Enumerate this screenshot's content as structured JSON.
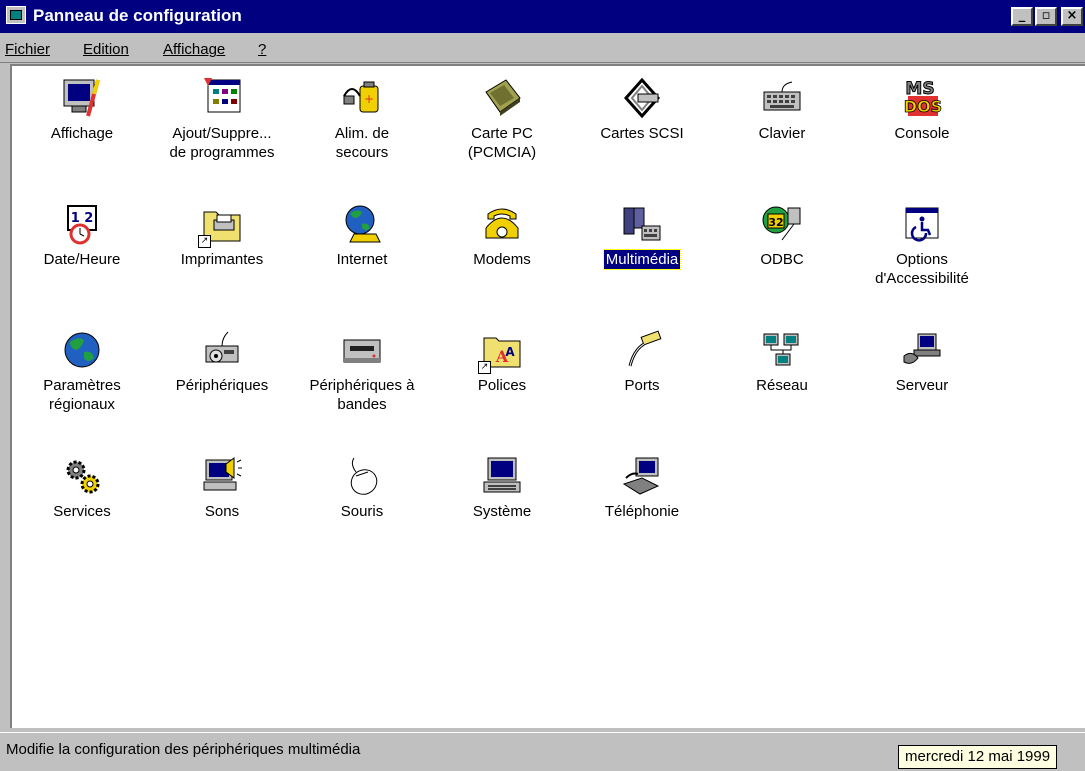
{
  "window": {
    "title": "Panneau de configuration",
    "minimize_symbol": "_",
    "maximize_symbol": "▫",
    "close_symbol": "×"
  },
  "menu": [
    "Fichier",
    "Edition",
    "Affichage",
    "?"
  ],
  "items": [
    {
      "label": "Affichage",
      "icon": "display-icon"
    },
    {
      "label": "Ajout/Suppre...\nde programmes",
      "icon": "add-remove-programs-icon"
    },
    {
      "label": "Alim. de\nsecours",
      "icon": "ups-icon"
    },
    {
      "label": "Carte PC\n(PCMCIA)",
      "icon": "pc-card-icon"
    },
    {
      "label": "Cartes SCSI",
      "icon": "scsi-icon"
    },
    {
      "label": "Clavier",
      "icon": "keyboard-icon"
    },
    {
      "label": "Console",
      "icon": "console-icon"
    },
    {
      "label": "Date/Heure",
      "icon": "calendar-clock-icon"
    },
    {
      "label": "Imprimantes",
      "icon": "printers-folder-icon"
    },
    {
      "label": "Internet",
      "icon": "internet-globe-phone-icon"
    },
    {
      "label": "Modems",
      "icon": "modem-phone-icon"
    },
    {
      "label": "Multimédia",
      "icon": "multimedia-icon",
      "selected": true
    },
    {
      "label": "ODBC",
      "icon": "odbc-icon"
    },
    {
      "label": "Options\nd'Accessibilité",
      "icon": "accessibility-icon"
    },
    {
      "label": "Paramètres\nrégionaux",
      "icon": "globe-icon"
    },
    {
      "label": "Périphériques",
      "icon": "devices-icon"
    },
    {
      "label": "Périphériques à\nbandes",
      "icon": "tape-drive-icon"
    },
    {
      "label": "Polices",
      "icon": "fonts-folder-icon"
    },
    {
      "label": "Ports",
      "icon": "port-cable-icon"
    },
    {
      "label": "Réseau",
      "icon": "network-icon"
    },
    {
      "label": "Serveur",
      "icon": "server-icon"
    },
    {
      "label": "Services",
      "icon": "gears-icon"
    },
    {
      "label": "Sons",
      "icon": "speaker-computer-icon"
    },
    {
      "label": "Souris",
      "icon": "mouse-icon"
    },
    {
      "label": "Système",
      "icon": "computer-icon"
    },
    {
      "label": "Téléphonie",
      "icon": "telephony-icon"
    }
  ],
  "status_text": "Modifie la configuration des périphériques multimédia",
  "tooltip": "mercredi 12 mai 1999"
}
